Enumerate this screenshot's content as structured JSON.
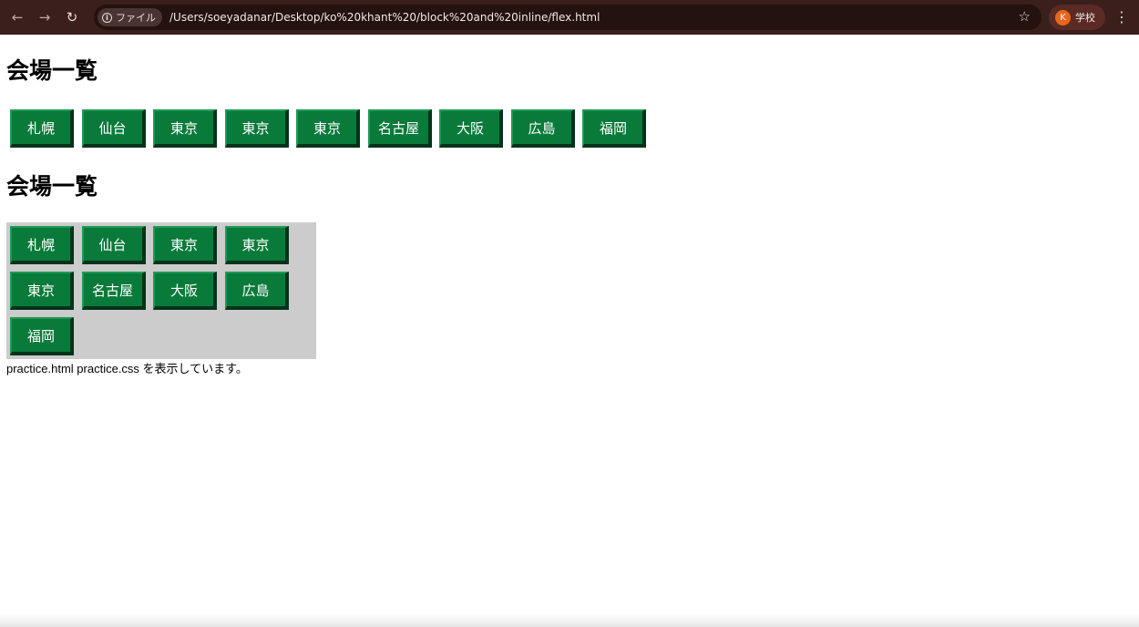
{
  "browser": {
    "chip_label": "ファイル",
    "url": "/Users/soeyadanar/Desktop/ko%20khant%20/block%20and%20inline/flex.html",
    "profile_initial": "K",
    "profile_name": "学校"
  },
  "page": {
    "heading_1": "会場一覧",
    "heading_2": "会場一覧",
    "row_buttons": [
      "札幌",
      "仙台",
      "東京",
      "東京",
      "東京",
      "名古屋",
      "大阪",
      "広島",
      "福岡"
    ],
    "flex_buttons": [
      "札幌",
      "仙台",
      "東京",
      "東京",
      "東京",
      "名古屋",
      "大阪",
      "広島",
      "福岡"
    ],
    "caption": "practice.html practice.css を表示しています。"
  },
  "colors": {
    "button_bg": "#0a7a3a",
    "flex_container_bg": "#cccccc",
    "chrome_bg": "#3a1f1c"
  }
}
